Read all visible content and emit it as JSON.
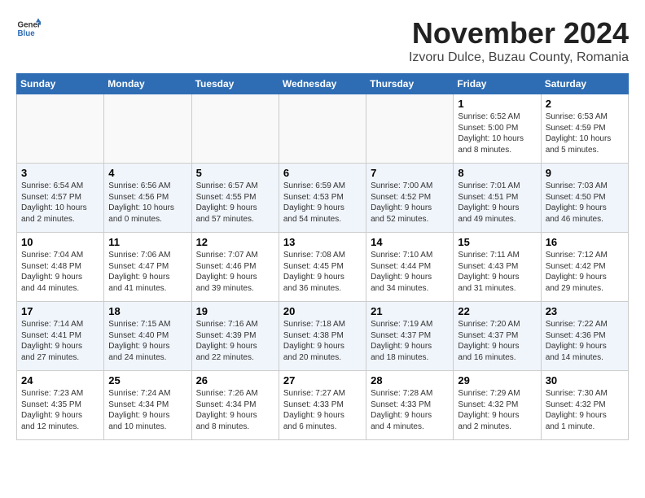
{
  "header": {
    "logo_general": "General",
    "logo_blue": "Blue",
    "month_title": "November 2024",
    "subtitle": "Izvoru Dulce, Buzau County, Romania"
  },
  "weekdays": [
    "Sunday",
    "Monday",
    "Tuesday",
    "Wednesday",
    "Thursday",
    "Friday",
    "Saturday"
  ],
  "weeks": [
    [
      {
        "day": "",
        "info": ""
      },
      {
        "day": "",
        "info": ""
      },
      {
        "day": "",
        "info": ""
      },
      {
        "day": "",
        "info": ""
      },
      {
        "day": "",
        "info": ""
      },
      {
        "day": "1",
        "info": "Sunrise: 6:52 AM\nSunset: 5:00 PM\nDaylight: 10 hours\nand 8 minutes."
      },
      {
        "day": "2",
        "info": "Sunrise: 6:53 AM\nSunset: 4:59 PM\nDaylight: 10 hours\nand 5 minutes."
      }
    ],
    [
      {
        "day": "3",
        "info": "Sunrise: 6:54 AM\nSunset: 4:57 PM\nDaylight: 10 hours\nand 2 minutes."
      },
      {
        "day": "4",
        "info": "Sunrise: 6:56 AM\nSunset: 4:56 PM\nDaylight: 10 hours\nand 0 minutes."
      },
      {
        "day": "5",
        "info": "Sunrise: 6:57 AM\nSunset: 4:55 PM\nDaylight: 9 hours\nand 57 minutes."
      },
      {
        "day": "6",
        "info": "Sunrise: 6:59 AM\nSunset: 4:53 PM\nDaylight: 9 hours\nand 54 minutes."
      },
      {
        "day": "7",
        "info": "Sunrise: 7:00 AM\nSunset: 4:52 PM\nDaylight: 9 hours\nand 52 minutes."
      },
      {
        "day": "8",
        "info": "Sunrise: 7:01 AM\nSunset: 4:51 PM\nDaylight: 9 hours\nand 49 minutes."
      },
      {
        "day": "9",
        "info": "Sunrise: 7:03 AM\nSunset: 4:50 PM\nDaylight: 9 hours\nand 46 minutes."
      }
    ],
    [
      {
        "day": "10",
        "info": "Sunrise: 7:04 AM\nSunset: 4:48 PM\nDaylight: 9 hours\nand 44 minutes."
      },
      {
        "day": "11",
        "info": "Sunrise: 7:06 AM\nSunset: 4:47 PM\nDaylight: 9 hours\nand 41 minutes."
      },
      {
        "day": "12",
        "info": "Sunrise: 7:07 AM\nSunset: 4:46 PM\nDaylight: 9 hours\nand 39 minutes."
      },
      {
        "day": "13",
        "info": "Sunrise: 7:08 AM\nSunset: 4:45 PM\nDaylight: 9 hours\nand 36 minutes."
      },
      {
        "day": "14",
        "info": "Sunrise: 7:10 AM\nSunset: 4:44 PM\nDaylight: 9 hours\nand 34 minutes."
      },
      {
        "day": "15",
        "info": "Sunrise: 7:11 AM\nSunset: 4:43 PM\nDaylight: 9 hours\nand 31 minutes."
      },
      {
        "day": "16",
        "info": "Sunrise: 7:12 AM\nSunset: 4:42 PM\nDaylight: 9 hours\nand 29 minutes."
      }
    ],
    [
      {
        "day": "17",
        "info": "Sunrise: 7:14 AM\nSunset: 4:41 PM\nDaylight: 9 hours\nand 27 minutes."
      },
      {
        "day": "18",
        "info": "Sunrise: 7:15 AM\nSunset: 4:40 PM\nDaylight: 9 hours\nand 24 minutes."
      },
      {
        "day": "19",
        "info": "Sunrise: 7:16 AM\nSunset: 4:39 PM\nDaylight: 9 hours\nand 22 minutes."
      },
      {
        "day": "20",
        "info": "Sunrise: 7:18 AM\nSunset: 4:38 PM\nDaylight: 9 hours\nand 20 minutes."
      },
      {
        "day": "21",
        "info": "Sunrise: 7:19 AM\nSunset: 4:37 PM\nDaylight: 9 hours\nand 18 minutes."
      },
      {
        "day": "22",
        "info": "Sunrise: 7:20 AM\nSunset: 4:37 PM\nDaylight: 9 hours\nand 16 minutes."
      },
      {
        "day": "23",
        "info": "Sunrise: 7:22 AM\nSunset: 4:36 PM\nDaylight: 9 hours\nand 14 minutes."
      }
    ],
    [
      {
        "day": "24",
        "info": "Sunrise: 7:23 AM\nSunset: 4:35 PM\nDaylight: 9 hours\nand 12 minutes."
      },
      {
        "day": "25",
        "info": "Sunrise: 7:24 AM\nSunset: 4:34 PM\nDaylight: 9 hours\nand 10 minutes."
      },
      {
        "day": "26",
        "info": "Sunrise: 7:26 AM\nSunset: 4:34 PM\nDaylight: 9 hours\nand 8 minutes."
      },
      {
        "day": "27",
        "info": "Sunrise: 7:27 AM\nSunset: 4:33 PM\nDaylight: 9 hours\nand 6 minutes."
      },
      {
        "day": "28",
        "info": "Sunrise: 7:28 AM\nSunset: 4:33 PM\nDaylight: 9 hours\nand 4 minutes."
      },
      {
        "day": "29",
        "info": "Sunrise: 7:29 AM\nSunset: 4:32 PM\nDaylight: 9 hours\nand 2 minutes."
      },
      {
        "day": "30",
        "info": "Sunrise: 7:30 AM\nSunset: 4:32 PM\nDaylight: 9 hours\nand 1 minute."
      }
    ]
  ]
}
